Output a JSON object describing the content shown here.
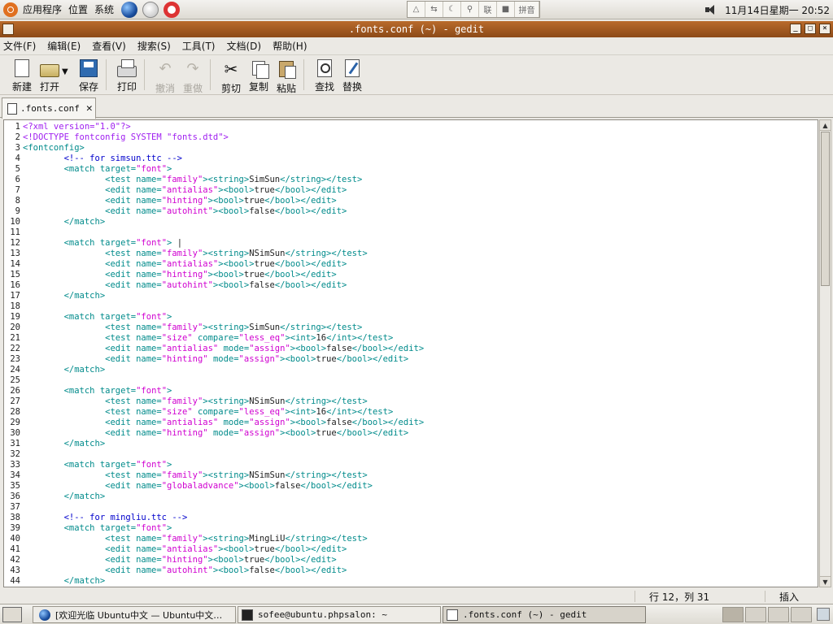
{
  "top_panel": {
    "menus": [
      "应用程序",
      "位置",
      "系统"
    ],
    "tray_items": [
      "linux-penguin-icon",
      "switch-icon",
      "moon-icon",
      "key-icon",
      "lock-icon"
    ],
    "tray_labels": [
      "联",
      "拼音"
    ],
    "clock": "11月14日星期一 20:52"
  },
  "window": {
    "title": ".fonts.conf (~) - gedit",
    "controls": [
      "_",
      "□",
      "×"
    ]
  },
  "menubar": [
    "文件(F)",
    "编辑(E)",
    "查看(V)",
    "搜索(S)",
    "工具(T)",
    "文档(D)",
    "帮助(H)"
  ],
  "toolbar": {
    "new": "新建",
    "open": "打开",
    "save": "保存",
    "print": "打印",
    "undo": "撤消",
    "redo": "重做",
    "cut": "剪切",
    "copy": "复制",
    "paste": "粘贴",
    "find": "查找",
    "replace": "替换"
  },
  "tab": {
    "label": ".fonts.conf"
  },
  "code_lines": [
    "<?xml version=\"1.0\"?>",
    "<!DOCTYPE fontconfig SYSTEM \"fonts.dtd\">",
    "<fontconfig>",
    "        <!-- for simsun.ttc -->",
    "        <match target=\"font\">",
    "                <test name=\"family\"><string>SimSun</string></test>",
    "                <edit name=\"antialias\"><bool>true</bool></edit>",
    "                <edit name=\"hinting\"><bool>true</bool></edit>",
    "                <edit name=\"autohint\"><bool>false</bool></edit>",
    "        </match>",
    "",
    "        <match target=\"font\"> |",
    "                <test name=\"family\"><string>NSimSun</string></test>",
    "                <edit name=\"antialias\"><bool>true</bool></edit>",
    "                <edit name=\"hinting\"><bool>true</bool></edit>",
    "                <edit name=\"autohint\"><bool>false</bool></edit>",
    "        </match>",
    "",
    "        <match target=\"font\">",
    "                <test name=\"family\"><string>SimSun</string></test>",
    "                <test name=\"size\" compare=\"less_eq\"><int>16</int></test>",
    "                <edit name=\"antialias\" mode=\"assign\"><bool>false</bool></edit>",
    "                <edit name=\"hinting\" mode=\"assign\"><bool>true</bool></edit>",
    "        </match>",
    "",
    "        <match target=\"font\">",
    "                <test name=\"family\"><string>NSimSun</string></test>",
    "                <test name=\"size\" compare=\"less_eq\"><int>16</int></test>",
    "                <edit name=\"antialias\" mode=\"assign\"><bool>false</bool></edit>",
    "                <edit name=\"hinting\" mode=\"assign\"><bool>true</bool></edit>",
    "        </match>",
    "",
    "        <match target=\"font\">",
    "                <test name=\"family\"><string>NSimSun</string></test>",
    "                <edit name=\"globaladvance\"><bool>false</bool></edit>",
    "        </match>",
    "",
    "        <!-- for mingliu.ttc -->",
    "        <match target=\"font\">",
    "                <test name=\"family\"><string>MingLiU</string></test>",
    "                <edit name=\"antialias\"><bool>true</bool></edit>",
    "                <edit name=\"hinting\"><bool>true</bool></edit>",
    "                <edit name=\"autohint\"><bool>false</bool></edit>",
    "        </match>"
  ],
  "status": {
    "position": "行 12，列 31",
    "mode": "插入"
  },
  "taskbar": {
    "tasks": [
      "[欢迎光临 Ubuntu中文 — Ubuntu中文…",
      "sofee@ubuntu.phpsalon: ~",
      ".fonts.conf (~) - gedit"
    ]
  },
  "colors": {
    "titlebar": "#a35c22",
    "tag": "#008b8b",
    "string": "#d000d0",
    "comment": "#0000cc",
    "preproc": "#a020f0"
  }
}
